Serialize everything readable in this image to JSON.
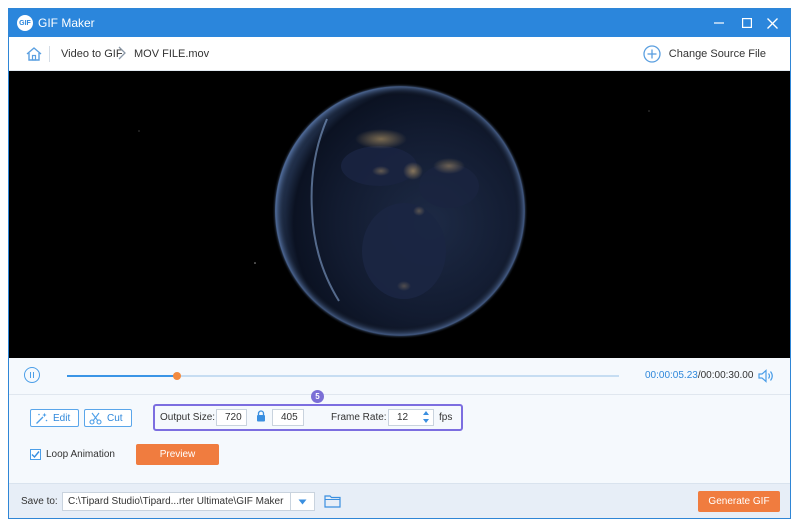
{
  "window": {
    "title": "GIF Maker",
    "app_icon_text": "GIF",
    "accent_color": "#2b86dc"
  },
  "nav": {
    "breadcrumb": [
      "Video to GIF",
      "MOV FILE.mov"
    ],
    "change_source_label": "Change Source File"
  },
  "playback": {
    "current_time": "00:00:05.23",
    "total_time": "/00:00:30.00",
    "progress": 0.2
  },
  "tools": {
    "edit_label": "Edit",
    "cut_label": "Cut",
    "step_badge": "5"
  },
  "output": {
    "size_label": "Output Size:",
    "width": "720",
    "height": "405",
    "frame_rate_label": "Frame Rate:",
    "frame_rate": "12",
    "fps_unit": "fps"
  },
  "loop": {
    "label": "Loop Animation",
    "checked": true
  },
  "buttons": {
    "preview_label": "Preview",
    "generate_label": "Generate GIF",
    "primary_color": "#f07c3f"
  },
  "save": {
    "label": "Save to:",
    "path": "C:\\Tipard Studio\\Tipard...rter Ultimate\\GIF Maker"
  }
}
